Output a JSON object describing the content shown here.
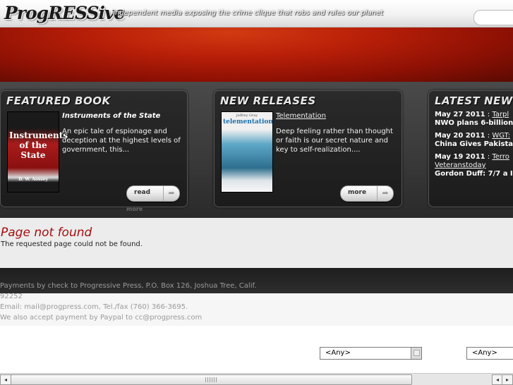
{
  "site": {
    "logo": "ProgRESSive",
    "tagline": "Independent media exposing the crime clique that robs and rules our planet"
  },
  "featured": {
    "heading": "FEATURED BOOK",
    "cover_title": "Instruments of the State",
    "cover_author": "D. W. Aossey",
    "book_title": "Instruments of the State",
    "description": "An epic tale of espionage and deception at the highest levels of government, this...",
    "button_label": "read",
    "more_label": "more"
  },
  "releases": {
    "heading": "NEW RELEASES",
    "cover_author": "Jeffrey Gray",
    "cover_title": "telementation",
    "book_title": "Telementation",
    "description": "Deep feeling rather than thought or faith is our secret nature and key to self-realization....",
    "button_label": "more"
  },
  "news": {
    "heading": "LATEST NEWS",
    "items": [
      {
        "date": "May 27 2011",
        "sep": " : ",
        "source": "Tarpl",
        "headline": "NWO plans 6-billion"
      },
      {
        "date": "May 20 2011",
        "sep": " : ",
        "source": "WGT:",
        "headline": "China Gives Pakista"
      },
      {
        "date": "May 19 2011",
        "sep": " : ",
        "source": "Terro",
        "source2": "Veteranstoday",
        "headline": "Gordon Duff: 7/7 a I"
      }
    ]
  },
  "page": {
    "title": "Page not found",
    "message": "The requested page could not be found."
  },
  "footer": {
    "line1": "Payments by check to Progressive Press, P.O. Box 126, Joshua Tree, Calif.",
    "line2": "92252",
    "line3": "Email: mail@progpress.com, Tel./fax (760) 366-3695.",
    "line4": "We also accept payment by Paypal to cc@progpress.com"
  },
  "filters": {
    "select1_value": "<Any>",
    "select2_value": "<Any>"
  },
  "scrollbar": {
    "left_arrow": "◂",
    "right_arrow": "▸",
    "right_arrow2": "▸"
  }
}
